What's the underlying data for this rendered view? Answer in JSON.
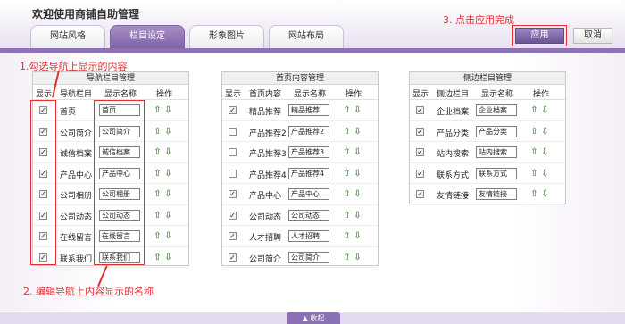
{
  "header": {
    "title": "欢迎使用商铺自助管理",
    "tabs": [
      {
        "label": "网站风格"
      },
      {
        "label": "栏目设定",
        "active": true
      },
      {
        "label": "形象图片"
      },
      {
        "label": "网站布局"
      }
    ],
    "apply_label": "应用",
    "cancel_label": "取消"
  },
  "columns": {
    "show": "显示",
    "name_nav": "导航栏目",
    "name_home": "首页内容",
    "name_side": "侧边栏目",
    "display": "显示名称",
    "action": "操作"
  },
  "panels": {
    "nav": {
      "title": "导航栏目管理",
      "rows": [
        {
          "name": "首页",
          "value": "首页",
          "checked": true
        },
        {
          "name": "公司简介",
          "value": "公司简介",
          "checked": true
        },
        {
          "name": "诚信档案",
          "value": "诚信档案",
          "checked": true
        },
        {
          "name": "产品中心",
          "value": "产品中心",
          "checked": true
        },
        {
          "name": "公司相册",
          "value": "公司相册",
          "checked": true
        },
        {
          "name": "公司动态",
          "value": "公司动态",
          "checked": true
        },
        {
          "name": "在线留言",
          "value": "在线留言",
          "checked": true
        },
        {
          "name": "联系我们",
          "value": "联系我们",
          "checked": true
        }
      ]
    },
    "home": {
      "title": "首页内容管理",
      "rows": [
        {
          "name": "精品推荐",
          "value": "精品推荐",
          "checked": true
        },
        {
          "name": "产品推荐2",
          "value": "产品推荐2",
          "checked": false
        },
        {
          "name": "产品推荐3",
          "value": "产品推荐3",
          "checked": false
        },
        {
          "name": "产品推荐4",
          "value": "产品推荐4",
          "checked": false
        },
        {
          "name": "产品中心",
          "value": "产品中心",
          "checked": true
        },
        {
          "name": "公司动态",
          "value": "公司动态",
          "checked": true
        },
        {
          "name": "人才招聘",
          "value": "人才招聘",
          "checked": true
        },
        {
          "name": "公司简介",
          "value": "公司简介",
          "checked": true
        }
      ]
    },
    "side": {
      "title": "侧边栏目管理",
      "rows": [
        {
          "name": "企业档案",
          "value": "企业档案",
          "checked": true
        },
        {
          "name": "产品分类",
          "value": "产品分类",
          "checked": true
        },
        {
          "name": "站内搜索",
          "value": "站内搜索",
          "checked": true
        },
        {
          "name": "联系方式",
          "value": "联系方式",
          "checked": true
        },
        {
          "name": "友情链接",
          "value": "友情链接",
          "checked": true
        }
      ]
    }
  },
  "annotations": {
    "a1": "1.勾选导航上显示的内容",
    "a2": "2. 编辑导航上内容显示的名称",
    "a3": "3.  点击应用完成"
  },
  "footer": {
    "collapse_label": "▲ 收起"
  },
  "icons": {
    "move_up": "arrow-up-icon",
    "move_down": "arrow-down-icon"
  },
  "colors": {
    "accent": "#8e72b6",
    "annotation": "#e03030",
    "arrow": "#35a022"
  }
}
